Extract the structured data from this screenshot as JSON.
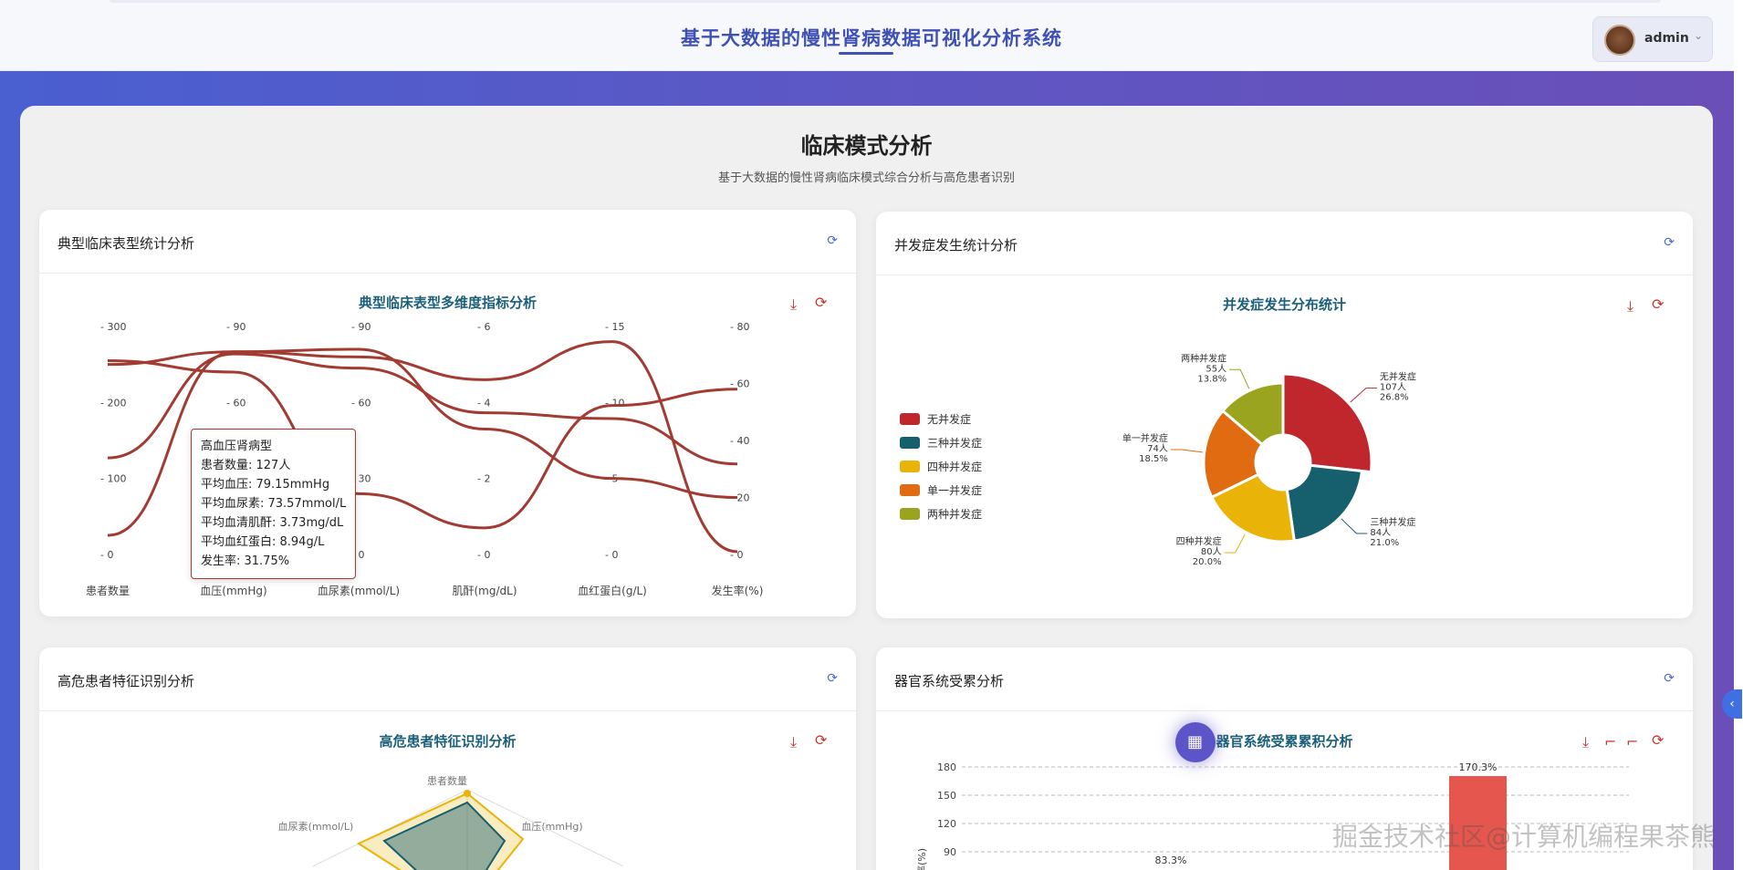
{
  "header": {
    "app_title": "基于大数据的慢性肾病数据可视化分析系统",
    "user_name": "admin"
  },
  "page": {
    "title": "临床模式分析",
    "subtitle": "基于大数据的慢性肾病临床模式综合分析与高危患者识别"
  },
  "cards": {
    "phenotype": {
      "title": "典型临床表型统计分析",
      "chart_title": "典型临床表型多维度指标分析",
      "axes": [
        {
          "name": "患者数量",
          "ticks": [
            "300",
            "200",
            "100",
            "0"
          ]
        },
        {
          "name": "血压(mmHg)",
          "ticks": [
            "90",
            "60",
            "30",
            "0"
          ]
        },
        {
          "name": "血尿素(mmol/L)",
          "ticks": [
            "90",
            "60",
            "30",
            "0"
          ]
        },
        {
          "name": "肌酐(mg/dL)",
          "ticks": [
            "6",
            "4",
            "2",
            "0"
          ]
        },
        {
          "name": "血红蛋白(g/L)",
          "ticks": [
            "15",
            "10",
            "5",
            "0"
          ]
        },
        {
          "name": "发生率(%)",
          "ticks": [
            "80",
            "60",
            "40",
            "20",
            "0"
          ]
        }
      ],
      "tooltip": {
        "title": "高血压肾病型",
        "lines": [
          "患者数量: 127人",
          "平均血压: 79.15mmHg",
          "平均血尿素: 73.57mmol/L",
          "平均血清肌酐: 3.73mg/dL",
          "平均血红蛋白: 8.94g/L",
          "发生率: 31.75%"
        ]
      }
    },
    "complication": {
      "title": "并发症发生统计分析",
      "chart_title": "并发症发生分布统计",
      "legend": [
        "无并发症",
        "三种并发症",
        "四种并发症",
        "单一并发症",
        "两种并发症"
      ],
      "labels": [
        {
          "name": "无并发症",
          "count": "107人",
          "pct": "26.8%"
        },
        {
          "name": "三种并发症",
          "count": "84人",
          "pct": "21.0%"
        },
        {
          "name": "四种并发症",
          "count": "80人",
          "pct": "20.0%"
        },
        {
          "name": "单一并发症",
          "count": "74人",
          "pct": "18.5%"
        },
        {
          "name": "两种并发症",
          "count": "55人",
          "pct": "13.8%"
        }
      ]
    },
    "highrisk": {
      "title": "高危患者特征识别分析",
      "chart_title": "高危患者特征识别分析",
      "radar_labels": [
        "患者数量",
        "血压(mmHg)",
        "血尿素(mmol/L)"
      ]
    },
    "organ": {
      "title": "器官系统受累分析",
      "chart_title": "器官系统受累累积分析",
      "yticks": [
        "180",
        "150",
        "120",
        "90"
      ],
      "ylabel": "率(%)",
      "value_labels": [
        "83.3%",
        "170.3%"
      ]
    }
  },
  "watermark": "掘金技术社区@计算机编程果茶熊",
  "chart_data": [
    {
      "type": "line",
      "title": "典型临床表型多维度指标分析",
      "parallel_axes": [
        "患者数量",
        "血压(mmHg)",
        "血尿素(mmol/L)",
        "肌酐(mg/dL)",
        "血红蛋白(g/L)",
        "发生率(%)"
      ],
      "axis_ranges": [
        [
          0,
          300
        ],
        [
          0,
          90
        ],
        [
          0,
          90
        ],
        [
          0,
          6
        ],
        [
          0,
          15
        ],
        [
          0,
          80
        ]
      ],
      "series": [
        {
          "values": [
            250,
            80,
            81,
            3.3,
            5.0,
            20
          ]
        },
        {
          "values": [
            127,
            79.15,
            73.57,
            3.73,
            8.94,
            31.75
          ]
        },
        {
          "values": [
            255,
            72,
            24,
            0.7,
            9.8,
            58
          ]
        },
        {
          "values": [
            25,
            80,
            78,
            4.6,
            14.0,
            1
          ]
        }
      ]
    },
    {
      "type": "pie",
      "title": "并发症发生分布统计",
      "colors": [
        "#c0272d",
        "#16606e",
        "#eab308",
        "#e06b10",
        "#9aa41e"
      ],
      "categories": [
        "无并发症",
        "三种并发症",
        "四种并发症",
        "单一并发症",
        "两种并发症"
      ],
      "values": [
        107,
        84,
        80,
        74,
        55
      ],
      "percent": [
        26.8,
        21.0,
        20.0,
        18.5,
        13.8
      ]
    },
    {
      "type": "bar",
      "title": "器官系统受累累积分析",
      "ylabel": "率(%)",
      "ylim": [
        90,
        180
      ],
      "values": [
        83.3,
        170.3
      ]
    }
  ]
}
